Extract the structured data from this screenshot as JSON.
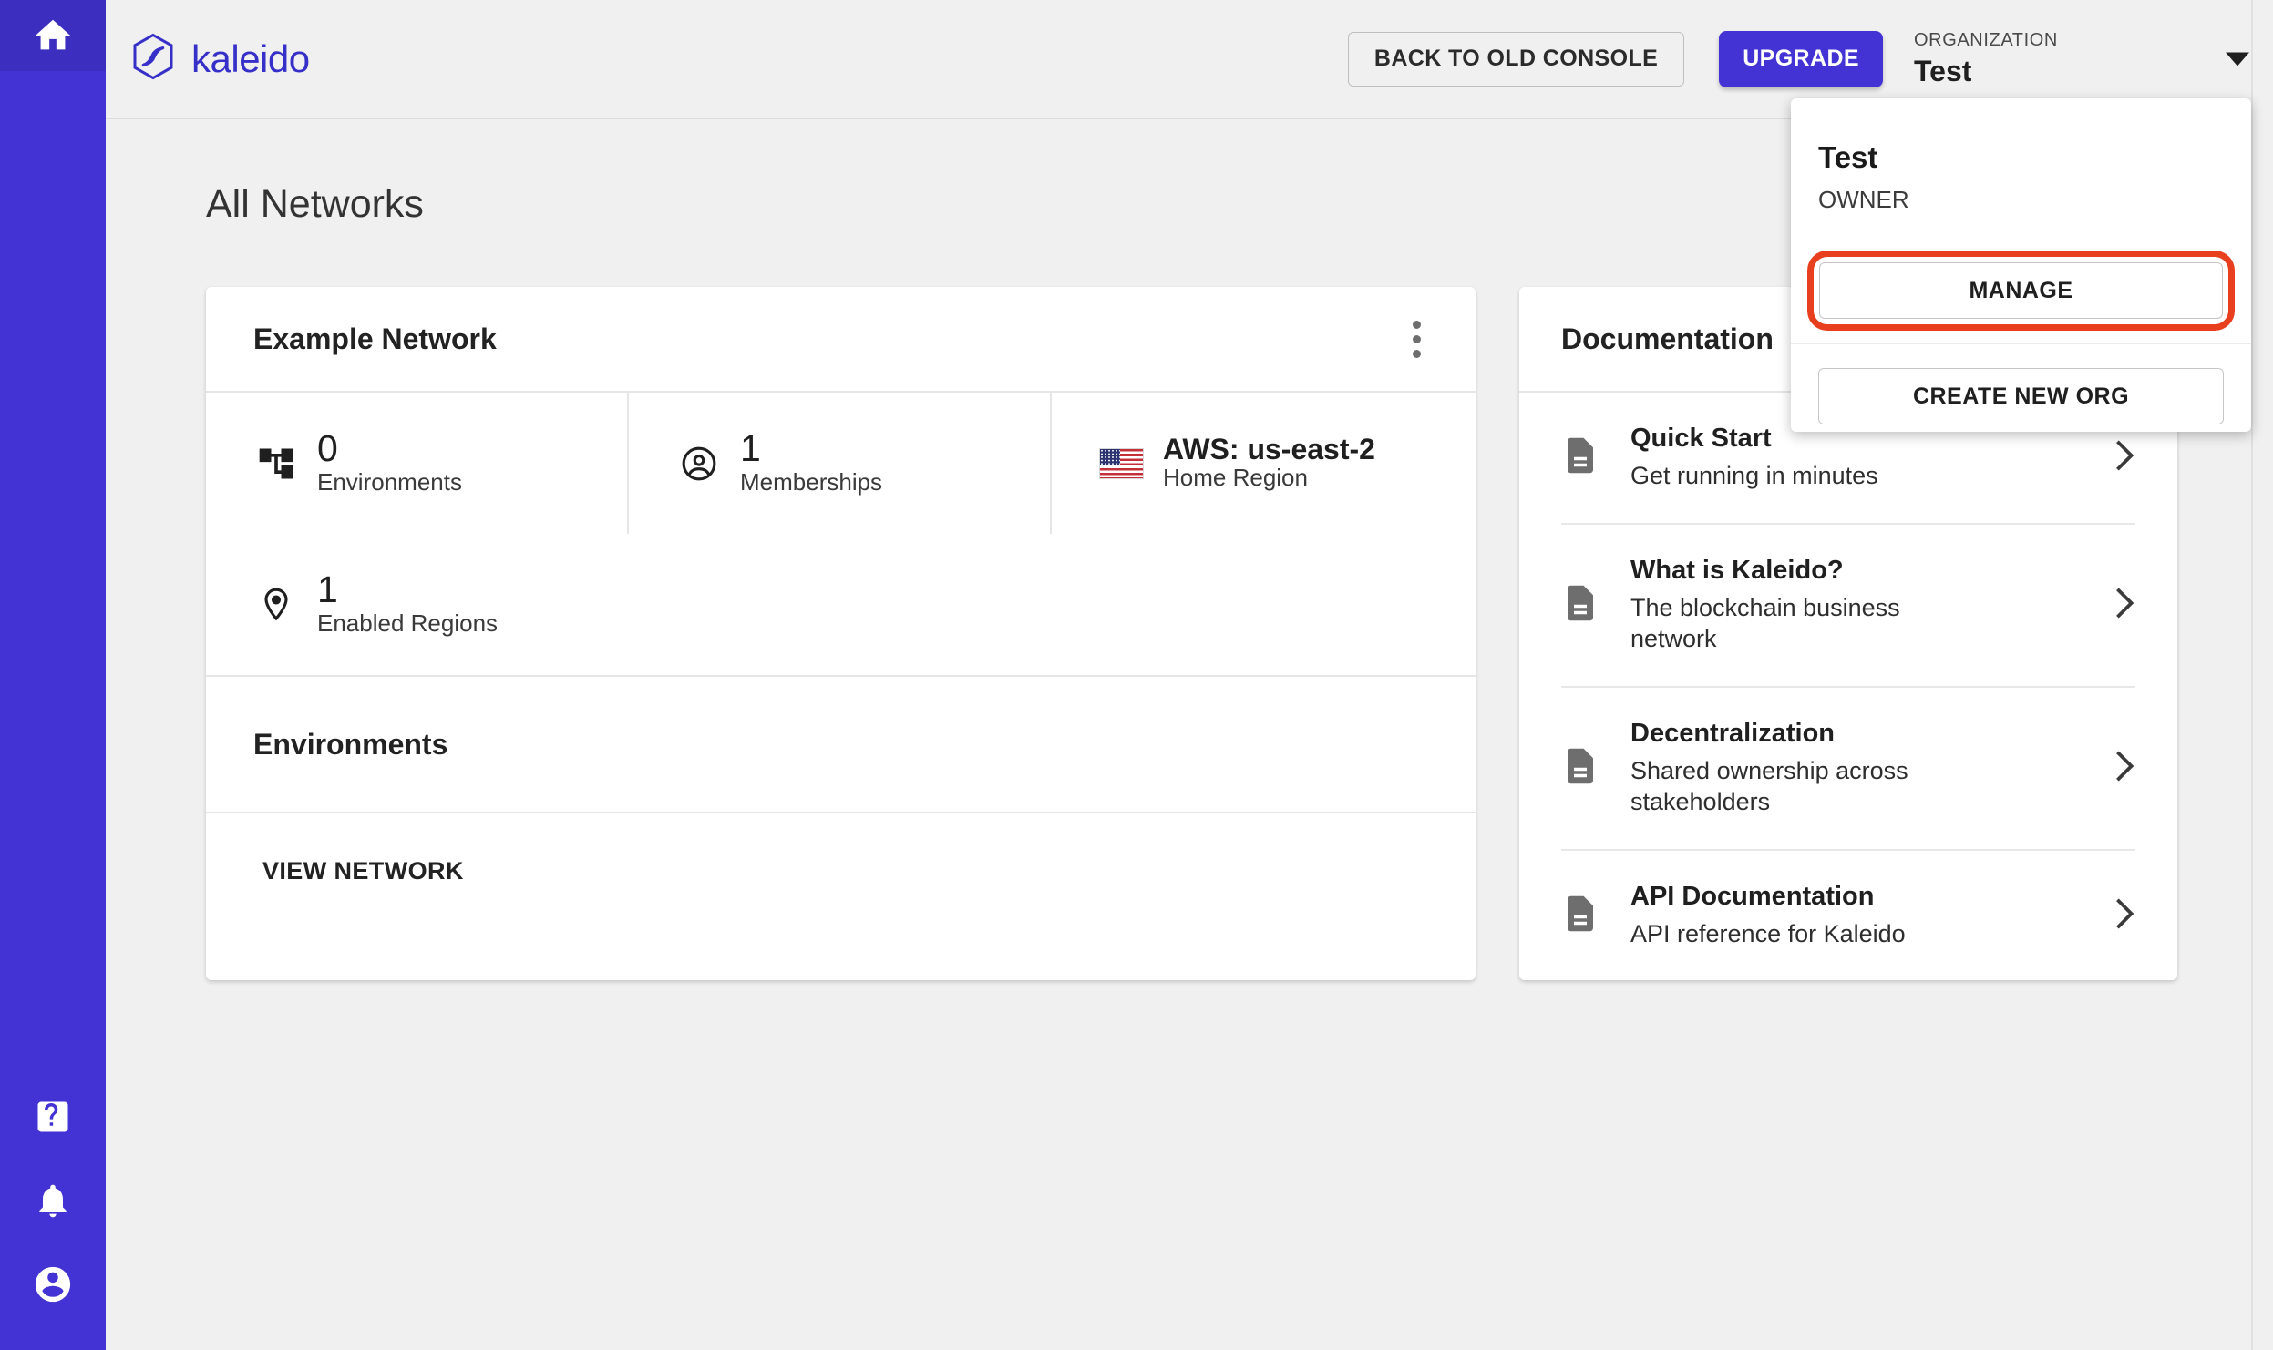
{
  "sidebar": {
    "items": [
      {
        "name": "home",
        "icon": "home-icon",
        "active": true
      }
    ],
    "bottom_items": [
      {
        "name": "help",
        "icon": "help-icon"
      },
      {
        "name": "notifications",
        "icon": "bell-icon"
      },
      {
        "name": "account",
        "icon": "account-circle-icon"
      }
    ]
  },
  "header": {
    "brand": "kaleido",
    "brand_color": "#3730c8",
    "back_to_old_console_label": "BACK TO OLD CONSOLE",
    "upgrade_label": "UPGRADE",
    "upgrade_color": "#4333d4",
    "organization_label": "ORGANIZATION",
    "organization_name": "Test",
    "caret_icon": "chevron-down-icon"
  },
  "org_menu": {
    "open": true,
    "name": "Test",
    "role": "OWNER",
    "manage_label": "MANAGE",
    "create_new_org_label": "CREATE NEW ORG",
    "highlight_color": "#e8401f"
  },
  "main": {
    "page_title": "All Networks",
    "network_card": {
      "title": "Example Network",
      "kebab_icon": "more-vert-icon",
      "stats": [
        {
          "icon": "account-tree-icon",
          "value": "0",
          "label": "Environments"
        },
        {
          "icon": "account-circle-icon",
          "value": "1",
          "label": "Memberships"
        },
        {
          "icon": "us-flag-icon",
          "value": "AWS: us-east-2",
          "label": "Home Region"
        },
        {
          "icon": "location-pin-icon",
          "value": "1",
          "label": "Enabled Regions"
        }
      ],
      "environments_section_label": "Environments",
      "view_network_label": "VIEW NETWORK"
    },
    "documentation_card": {
      "title": "Documentation",
      "items": [
        {
          "icon": "document-icon",
          "title": "Quick Start",
          "subtitle": "Get running in minutes",
          "arrow": "chevron-right-icon"
        },
        {
          "icon": "document-icon",
          "title": "What is Kaleido?",
          "subtitle": "The blockchain business network",
          "arrow": "chevron-right-icon"
        },
        {
          "icon": "document-icon",
          "title": "Decentralization",
          "subtitle": "Shared ownership across stakeholders",
          "arrow": "chevron-right-icon"
        },
        {
          "icon": "document-icon",
          "title": "API Documentation",
          "subtitle": "API reference for Kaleido",
          "arrow": "chevron-right-icon"
        }
      ]
    }
  }
}
